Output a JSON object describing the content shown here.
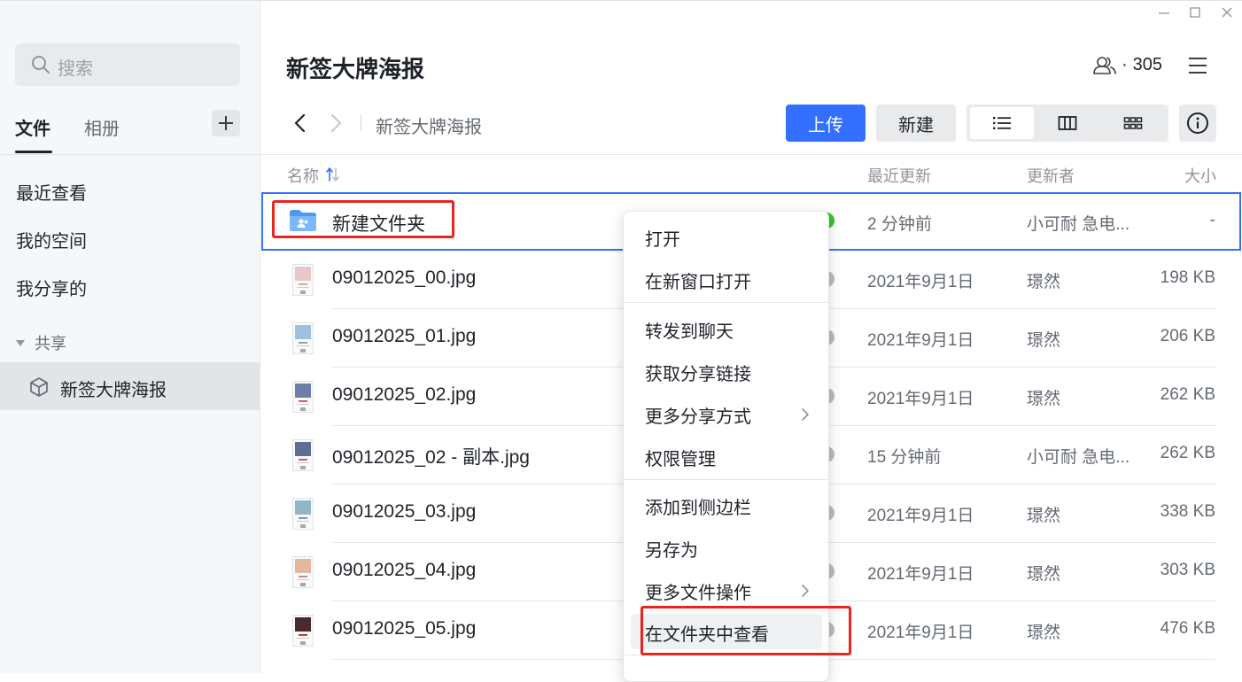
{
  "sidebar": {
    "search_placeholder": "搜索",
    "tabs": [
      {
        "label": "文件",
        "active": true
      },
      {
        "label": "相册",
        "active": false
      }
    ],
    "nav_items": [
      {
        "label": "最近查看"
      },
      {
        "label": "我的空间"
      },
      {
        "label": "我分享的"
      }
    ],
    "section_title": "共享",
    "shared_items": [
      {
        "label": "新签大牌海报",
        "selected": true
      }
    ]
  },
  "header": {
    "title": "新签大牌海报",
    "member_separator": "·",
    "member_count": "305"
  },
  "toolbar": {
    "breadcrumb": "新签大牌海报",
    "upload_label": "上传",
    "new_label": "新建",
    "active_view": "list"
  },
  "columns": {
    "name": "名称",
    "updated": "最近更新",
    "updater": "更新者",
    "size": "大小"
  },
  "files": [
    {
      "name": "新建文件夹",
      "updated": "2 分钟前",
      "updater": "小可耐 急电...",
      "size": "-",
      "type": "folder",
      "selected": true
    },
    {
      "name": "09012025_00.jpg",
      "updated": "2021年9月1日",
      "updater": "璟然",
      "size": "198 KB",
      "type": "image"
    },
    {
      "name": "09012025_01.jpg",
      "updated": "2021年9月1日",
      "updater": "璟然",
      "size": "206 KB",
      "type": "image"
    },
    {
      "name": "09012025_02.jpg",
      "updated": "2021年9月1日",
      "updater": "璟然",
      "size": "262 KB",
      "type": "image"
    },
    {
      "name": "09012025_02 - 副本.jpg",
      "updated": "15 分钟前",
      "updater": "小可耐 急电...",
      "size": "262 KB",
      "type": "image"
    },
    {
      "name": "09012025_03.jpg",
      "updated": "2021年9月1日",
      "updater": "璟然",
      "size": "338 KB",
      "type": "image"
    },
    {
      "name": "09012025_04.jpg",
      "updated": "2021年9月1日",
      "updater": "璟然",
      "size": "303 KB",
      "type": "image"
    },
    {
      "name": "09012025_05.jpg",
      "updated": "2021年9月1日",
      "updater": "璟然",
      "size": "476 KB",
      "type": "image"
    }
  ],
  "context_menu": {
    "items": [
      {
        "label": "打开"
      },
      {
        "label": "在新窗口打开"
      },
      {
        "label": "转发到聊天"
      },
      {
        "label": "获取分享链接"
      },
      {
        "label": "更多分享方式",
        "submenu": true
      },
      {
        "label": "权限管理"
      },
      {
        "label": "添加到侧边栏"
      },
      {
        "label": "另存为"
      },
      {
        "label": "更多文件操作",
        "submenu": true
      },
      {
        "label": "在文件夹中查看",
        "hovered": true
      }
    ]
  },
  "colors": {
    "accent": "#3370ff",
    "highlight_box": "#e8251f",
    "status_green": "#34c724"
  },
  "icons": [
    "search-icon",
    "plus-icon",
    "cube-icon",
    "minimize-icon",
    "maximize-icon",
    "close-icon",
    "members-icon",
    "menu-icon",
    "chevron-left-icon",
    "chevron-right-icon",
    "list-view-icon",
    "column-view-icon",
    "grid-view-icon",
    "info-icon",
    "sort-icon",
    "folder-icon",
    "image-thumbnail-icon"
  ]
}
